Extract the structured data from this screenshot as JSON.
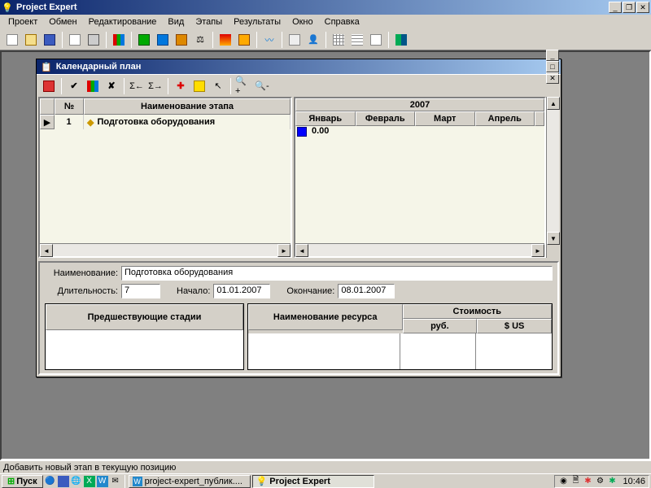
{
  "app_title": "Project Expert",
  "menu": {
    "project": "Проект",
    "exchange": "Обмен",
    "edit": "Редактирование",
    "view": "Вид",
    "stages": "Этапы",
    "results": "Результаты",
    "window": "Окно",
    "help": "Справка"
  },
  "child_window": {
    "title": "Календарный план"
  },
  "grid": {
    "col_num": "№",
    "col_name": "Наименование этапа",
    "rows": [
      {
        "num": "1",
        "name": "Подготовка оборудования"
      }
    ]
  },
  "gantt": {
    "year": "2007",
    "months": [
      "Январь",
      "Февраль",
      "Март",
      "Апрель"
    ],
    "value": "0.00"
  },
  "details": {
    "label_name": "Наименование:",
    "name_value": "Подготовка оборудования",
    "label_duration": "Длительность:",
    "duration_value": "7",
    "label_start": "Начало:",
    "start_value": "01.01.2007",
    "label_end": "Окончание:",
    "end_value": "08.01.2007",
    "col_predecessors": "Предшествующие стадии",
    "col_resource": "Наименование ресурса",
    "col_cost": "Стоимость",
    "col_rub": "руб.",
    "col_usd": "$ US"
  },
  "statusbar": "Добавить новый этап в текущую позицию",
  "taskbar": {
    "start": "Пуск",
    "task1": "project-expert_публик....",
    "task2": "Project Expert",
    "clock": "10:46"
  }
}
